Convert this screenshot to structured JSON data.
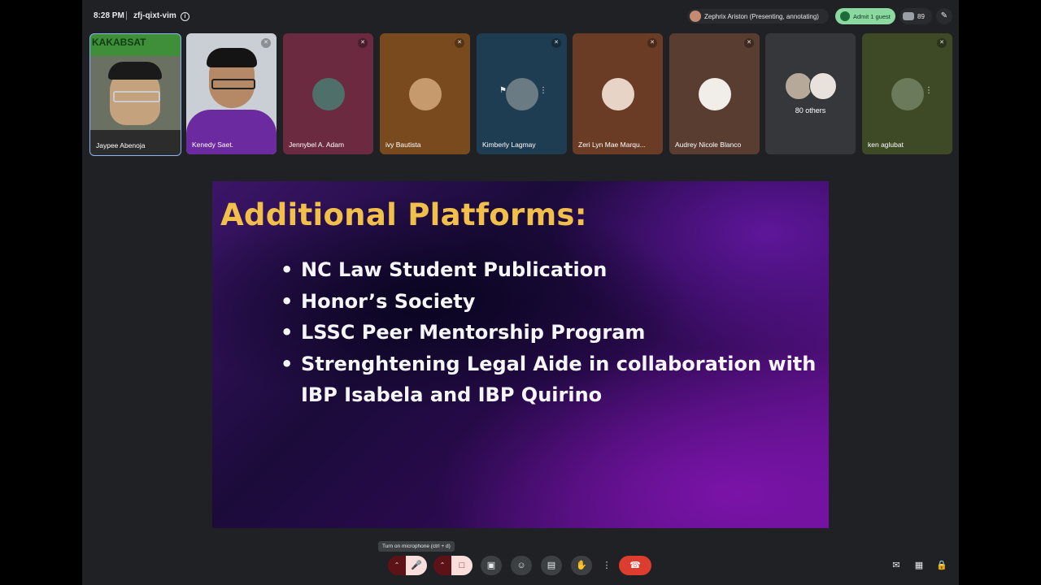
{
  "meeting": {
    "time": "8:28 PM",
    "separator": "|",
    "code": "zfj-qixt-vim"
  },
  "header": {
    "presenter_chip": "Zephrix Ariston (Presenting, annotating)",
    "admit_button": "Admit 1 guest",
    "participant_count": "89"
  },
  "participants": [
    {
      "name": "Jaypee Abenoja",
      "banner": "KAKABSAT"
    },
    {
      "name": "Kenedy Saet."
    },
    {
      "name": "Jennybel A. Adam"
    },
    {
      "name": "ivy Bautista"
    },
    {
      "name": "Kimberly Lagmay"
    },
    {
      "name": "Zeri Lyn Mae Marqu..."
    },
    {
      "name": "Audrey Nicole Blanco"
    },
    {
      "name": "80 others"
    },
    {
      "name": "ken aglubat"
    }
  ],
  "slide": {
    "title": "Additional Platforms:",
    "bullets": [
      "NC Law Student Publication",
      "Honor’s Society",
      "LSSC Peer Mentorship Program",
      "Strenghtening Legal Aide in collaboration with IBP Isabela and IBP Quirino"
    ]
  },
  "controls": {
    "mic_tooltip": "Turn on microphone (ctrl + d)"
  },
  "colors": {
    "slide_title": "#f2c04a",
    "end_call": "#dc3d2e",
    "admit": "#8bd9a0",
    "active_speaker": "#8ab4f8"
  }
}
